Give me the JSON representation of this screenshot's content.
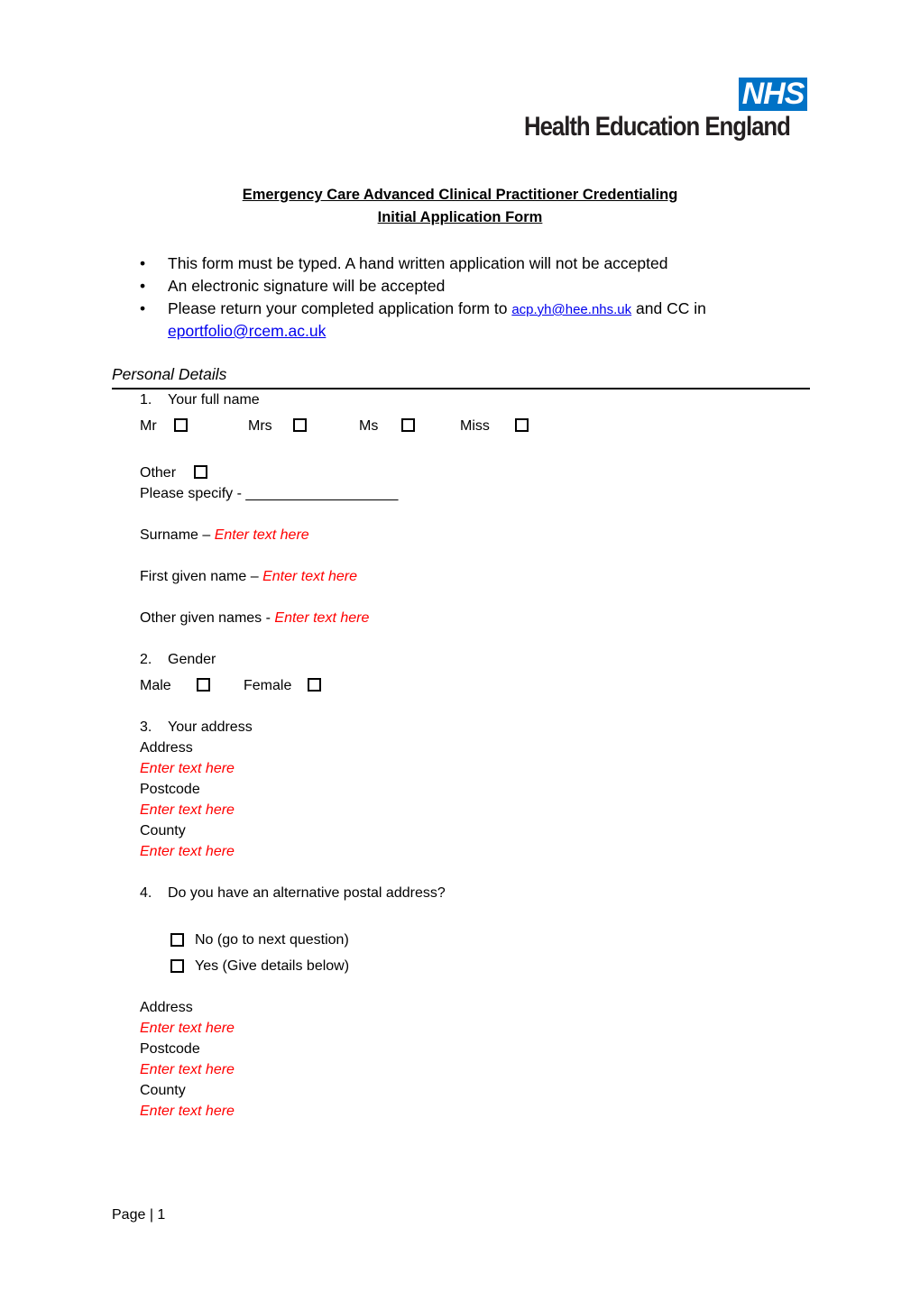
{
  "header": {
    "logo_nhs": "NHS",
    "logo_org": "Health Education England",
    "colors": {
      "nhs_blue": "#0072c6",
      "placeholder_red": "#ff0000",
      "link_blue": "#0000ee"
    }
  },
  "title": {
    "line1": "Emergency Care Advanced Clinical Practitioner Credentialing",
    "line2": "Initial Application Form"
  },
  "instructions": {
    "bullet_icon": "•",
    "items": [
      "This form must be typed. A hand written application will not be accepted",
      "An electronic signature will be accepted"
    ],
    "return": {
      "prefix": "Please return your completed application form to",
      "email1": "acp.yh@hee.nhs.uk",
      "middle": "and CC in",
      "email2": "eportfolio@rcem.ac.uk"
    }
  },
  "section": {
    "title": "Personal Details"
  },
  "q1": {
    "number": "1.",
    "label": "Your full name",
    "titles": [
      "Mr",
      "Mrs",
      "Ms",
      "Miss",
      "Other"
    ],
    "specify_label": "Please specify - ___________________",
    "surname_label": "Surname – ",
    "first_name_label": "First given name – ",
    "other_names_label": "Other given names - ",
    "placeholder": "Enter text here"
  },
  "q2": {
    "number": "2.",
    "label": "Gender",
    "options": [
      "Male",
      "Female"
    ]
  },
  "q3": {
    "number": "3.",
    "label": "Your address",
    "fields": [
      "Address",
      "Postcode",
      "County"
    ],
    "placeholder": "Enter text here"
  },
  "q4": {
    "number": "4.",
    "label": "Do you have an alternative postal address?",
    "options": [
      "No (go to next question)",
      "Yes (Give details below)"
    ],
    "fields": [
      "Address",
      "Postcode",
      "County"
    ],
    "placeholder": "Enter text here"
  },
  "footer": {
    "page_label": "Page | 1"
  }
}
